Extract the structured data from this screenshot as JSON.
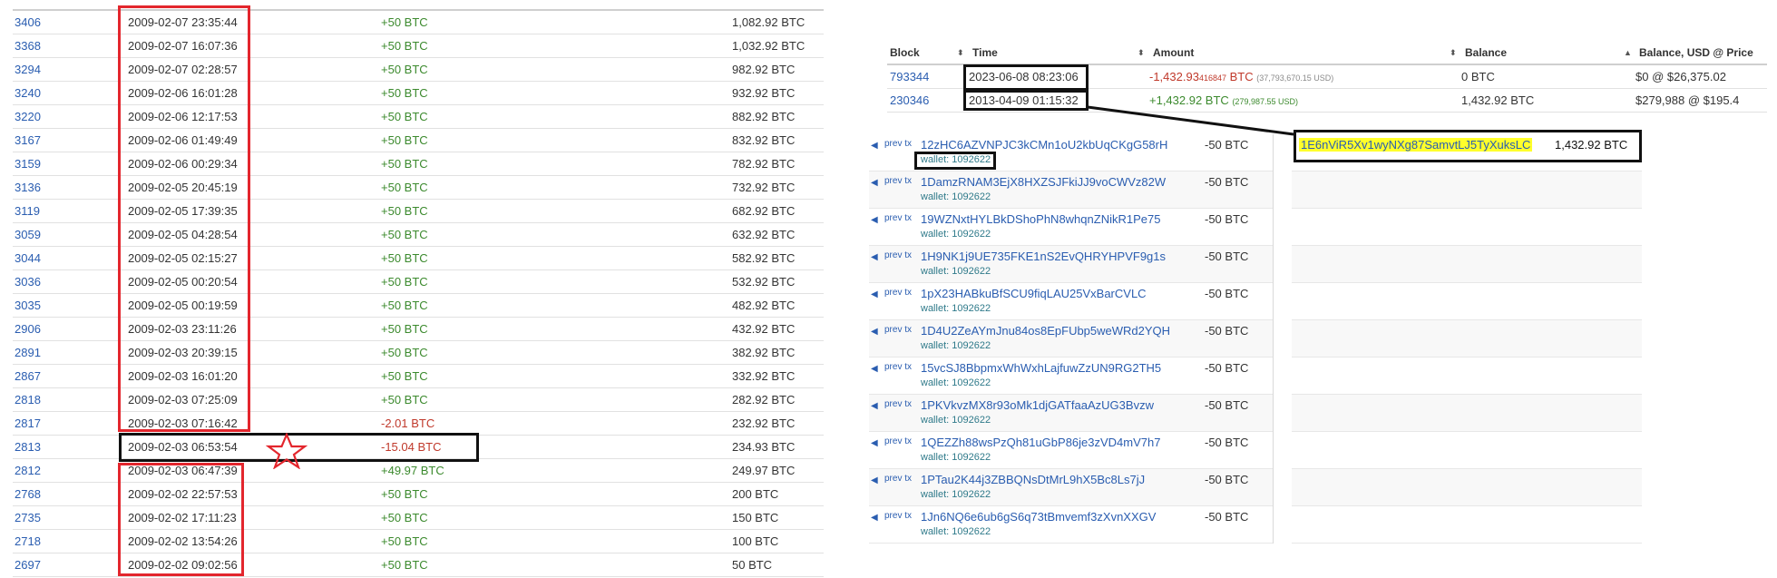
{
  "history": [
    {
      "block": "3406",
      "time": "2009-02-07 23:35:44",
      "amount": "+50 BTC",
      "balance": "1,082.92 BTC",
      "sign": "pos"
    },
    {
      "block": "3368",
      "time": "2009-02-07 16:07:36",
      "amount": "+50 BTC",
      "balance": "1,032.92 BTC",
      "sign": "pos"
    },
    {
      "block": "3294",
      "time": "2009-02-07 02:28:57",
      "amount": "+50 BTC",
      "balance": "982.92 BTC",
      "sign": "pos"
    },
    {
      "block": "3240",
      "time": "2009-02-06 16:01:28",
      "amount": "+50 BTC",
      "balance": "932.92 BTC",
      "sign": "pos"
    },
    {
      "block": "3220",
      "time": "2009-02-06 12:17:53",
      "amount": "+50 BTC",
      "balance": "882.92 BTC",
      "sign": "pos"
    },
    {
      "block": "3167",
      "time": "2009-02-06 01:49:49",
      "amount": "+50 BTC",
      "balance": "832.92 BTC",
      "sign": "pos"
    },
    {
      "block": "3159",
      "time": "2009-02-06 00:29:34",
      "amount": "+50 BTC",
      "balance": "782.92 BTC",
      "sign": "pos"
    },
    {
      "block": "3136",
      "time": "2009-02-05 20:45:19",
      "amount": "+50 BTC",
      "balance": "732.92 BTC",
      "sign": "pos"
    },
    {
      "block": "3119",
      "time": "2009-02-05 17:39:35",
      "amount": "+50 BTC",
      "balance": "682.92 BTC",
      "sign": "pos"
    },
    {
      "block": "3059",
      "time": "2009-02-05 04:28:54",
      "amount": "+50 BTC",
      "balance": "632.92 BTC",
      "sign": "pos"
    },
    {
      "block": "3044",
      "time": "2009-02-05 02:15:27",
      "amount": "+50 BTC",
      "balance": "582.92 BTC",
      "sign": "pos"
    },
    {
      "block": "3036",
      "time": "2009-02-05 00:20:54",
      "amount": "+50 BTC",
      "balance": "532.92 BTC",
      "sign": "pos"
    },
    {
      "block": "3035",
      "time": "2009-02-05 00:19:59",
      "amount": "+50 BTC",
      "balance": "482.92 BTC",
      "sign": "pos"
    },
    {
      "block": "2906",
      "time": "2009-02-03 23:11:26",
      "amount": "+50 BTC",
      "balance": "432.92 BTC",
      "sign": "pos"
    },
    {
      "block": "2891",
      "time": "2009-02-03 20:39:15",
      "amount": "+50 BTC",
      "balance": "382.92 BTC",
      "sign": "pos"
    },
    {
      "block": "2867",
      "time": "2009-02-03 16:01:20",
      "amount": "+50 BTC",
      "balance": "332.92 BTC",
      "sign": "pos"
    },
    {
      "block": "2818",
      "time": "2009-02-03 07:25:09",
      "amount": "+50 BTC",
      "balance": "282.92 BTC",
      "sign": "pos"
    },
    {
      "block": "2817",
      "time": "2009-02-03 07:16:42",
      "amount": "-2.01 BTC",
      "balance": "232.92 BTC",
      "sign": "neg"
    },
    {
      "block": "2813",
      "time": "2009-02-03 06:53:54",
      "amount": "-15.04 BTC",
      "balance": "234.93 BTC",
      "sign": "neg"
    },
    {
      "block": "2812",
      "time": "2009-02-03 06:47:39",
      "amount": "+49.97 BTC",
      "balance": "249.97 BTC",
      "sign": "pos"
    },
    {
      "block": "2768",
      "time": "2009-02-02 22:57:53",
      "amount": "+50 BTC",
      "balance": "200 BTC",
      "sign": "pos"
    },
    {
      "block": "2735",
      "time": "2009-02-02 17:11:23",
      "amount": "+50 BTC",
      "balance": "150 BTC",
      "sign": "pos"
    },
    {
      "block": "2718",
      "time": "2009-02-02 13:54:26",
      "amount": "+50 BTC",
      "balance": "100 BTC",
      "sign": "pos"
    },
    {
      "block": "2697",
      "time": "2009-02-02 09:02:56",
      "amount": "+50 BTC",
      "balance": "50 BTC",
      "sign": "pos"
    }
  ],
  "address_table": {
    "headers": {
      "block": "Block",
      "time": "Time",
      "amount": "Amount",
      "balance": "Balance",
      "balance_usd": "Balance, USD @ Price"
    },
    "sort_icons": {
      "both": "⬍",
      "up": "▲"
    },
    "rows": [
      {
        "block": "793344",
        "time": "2023-06-08 08:23:06",
        "amount": "-1,432.93",
        "amount_extra": "416847",
        "amount_unit": "BTC",
        "amount_usd": "(37,793,670.15 USD)",
        "balance": "0 BTC",
        "balance_usd": "$0 @ $26,375.02",
        "sign": "neg"
      },
      {
        "block": "230346",
        "time": "2013-04-09 01:15:32",
        "amount": "+1,432.92 BTC",
        "amount_extra": "",
        "amount_unit": "",
        "amount_usd": "(279,987.55 USD)",
        "balance": "1,432.92 BTC",
        "balance_usd": "$279,988 @ $195.4",
        "sign": "pos"
      }
    ]
  },
  "tx": {
    "prev_tx_label": "prev tx",
    "arrow_glyph": "◀",
    "inputs": [
      {
        "address": "12zHC6AZVNPJC3kCMn1oU2kbUqCKgG58rH",
        "wallet": "wallet: 1092622",
        "amount": "-50 BTC"
      },
      {
        "address": "1DamzRNAM3EjX8HXZSJFkiJJ9voCWVz82W",
        "wallet": "wallet: 1092622",
        "amount": "-50 BTC"
      },
      {
        "address": "19WZNxtHYLBkDShoPhN8whqnZNikR1Pe75",
        "wallet": "wallet: 1092622",
        "amount": "-50 BTC"
      },
      {
        "address": "1H9NK1j9UE735FKE1nS2EvQHRYHPVF9g1s",
        "wallet": "wallet: 1092622",
        "amount": "-50 BTC"
      },
      {
        "address": "1pX23HABkuBfSCU9fiqLAU25VxBarCVLC",
        "wallet": "wallet: 1092622",
        "amount": "-50 BTC"
      },
      {
        "address": "1D4U2ZeAYmJnu84os8EpFUbp5weWRd2YQH",
        "wallet": "wallet: 1092622",
        "amount": "-50 BTC"
      },
      {
        "address": "15vcSJ8BbpmxWhWxhLajfuwZzUN9RG2TH5",
        "wallet": "wallet: 1092622",
        "amount": "-50 BTC"
      },
      {
        "address": "1PKVkvzMX8r93oMk1djGATfaaAzUG3Bvzw",
        "wallet": "wallet: 1092622",
        "amount": "-50 BTC"
      },
      {
        "address": "1QEZZh88wsPzQh81uGbP86je3zVD4mV7h7",
        "wallet": "wallet: 1092622",
        "amount": "-50 BTC"
      },
      {
        "address": "1PTau2K44j3ZBBQNsDtMrL9hX5Bc8Ls7jJ",
        "wallet": "wallet: 1092622",
        "amount": "-50 BTC"
      },
      {
        "address": "1Jn6NQ6e6ub6gS6q73tBmvemf3zXvnXXGV",
        "wallet": "wallet: 1092622",
        "amount": "-50 BTC"
      }
    ],
    "output": {
      "address": "1E6nViR5Xv1wyNXg87SamvtLJ5TyXuksLC",
      "amount": "1,432.92 BTC"
    }
  },
  "annotation": {
    "star_glyph": "☆"
  },
  "colors": {
    "positive": "#3c8a2e",
    "negative": "#c0392b",
    "link": "#2a5db0",
    "highlight": "#ffff2b",
    "red_box": "#e3262d",
    "black_box": "#111111"
  }
}
